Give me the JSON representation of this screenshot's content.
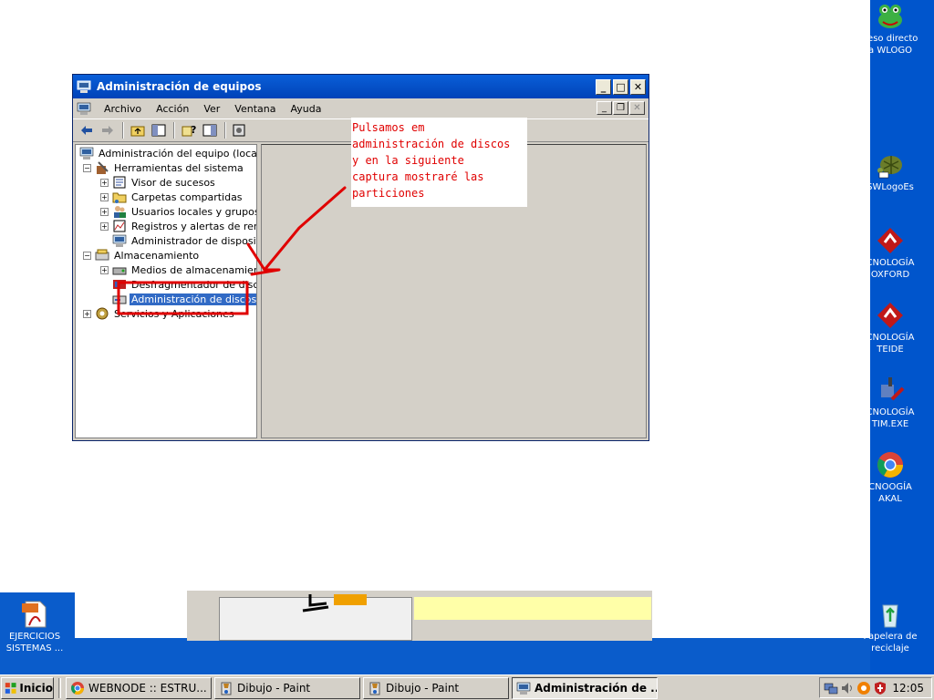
{
  "window": {
    "title": "Administración de equipos",
    "menu": [
      "Archivo",
      "Acción",
      "Ver",
      "Ventana",
      "Ayuda"
    ]
  },
  "tree": {
    "root": "Administración del equipo (local)",
    "system_tools": "Herramientas del sistema",
    "event_viewer": "Visor de sucesos",
    "shared_folders": "Carpetas compartidas",
    "local_users": "Usuarios locales y grupos",
    "perf_logs": "Registros y alertas de rendir",
    "device_manager": "Administrador de dispositiv",
    "storage": "Almacenamiento",
    "removable_storage": "Medios de almacenamiento",
    "defrag": "Desfragmentador de disco",
    "disk_mgmt": "Administración de discos",
    "services": "Servicios y Aplicaciones"
  },
  "annotation": {
    "text": "Pulsamos em\nadministración de discos\ny en la siguiente\ncaptura mostraré las\nparticiones",
    "color": "#e00000"
  },
  "desktop_icons": [
    {
      "line1": "ceso directo",
      "line2": "a WLOGO"
    },
    {
      "line1": "SWLogoEs",
      "line2": ""
    },
    {
      "line1": "CNOLOGÍA",
      "line2": "OXFORD"
    },
    {
      "line1": "CNOLOGÍA",
      "line2": "TEIDE"
    },
    {
      "line1": "CNOLOGÍA",
      "line2": "TIM.EXE"
    },
    {
      "line1": "CNOOGÍA",
      "line2": "AKAL"
    },
    {
      "line1": "Papelera de",
      "line2": "reciclaje"
    },
    {
      "line1": "EJERCICIOS",
      "line2": "SISTEMAS ..."
    }
  ],
  "taskbar": {
    "start": "Inicio",
    "tasks": [
      "WEBNODE :: ESTRU...",
      "Dibujo - Paint",
      "Dibujo - Paint",
      "Administración de ..."
    ],
    "clock": "12:05"
  },
  "colors": {
    "title_bar": "#0a5fd8",
    "selection": "#316ac5",
    "desktop": "#0055cc"
  }
}
